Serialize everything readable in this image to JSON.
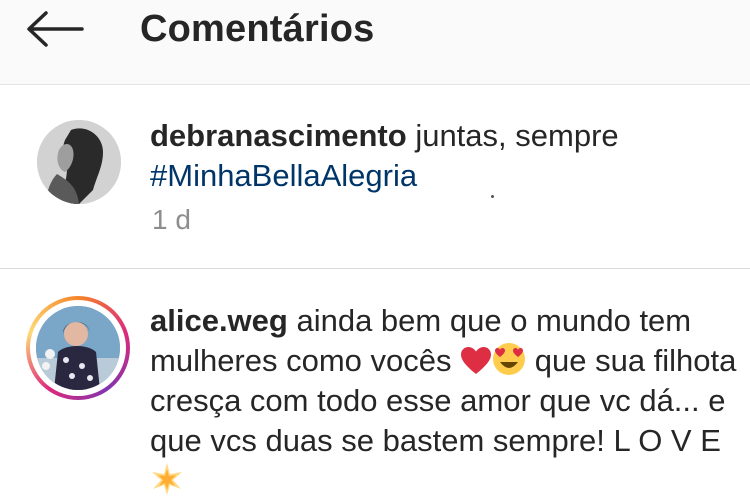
{
  "header": {
    "back_icon": "arrow-left-icon",
    "title": "Comentários"
  },
  "caption": {
    "username": "debranascimento",
    "text": " juntas, sempre",
    "hashtag": "#MinhaBellaAlegria",
    "time": "1 d"
  },
  "comment": {
    "username": "alice.weg",
    "text_part1": " ainda bem que o mundo tem mulheres como vocês ",
    "text_part2": " que sua filhota cresça com todo esse amor que vc dá... e que vcs duas se bastem sempre! L O V E ",
    "emojis": [
      "red-heart-icon",
      "heart-eyes-icon",
      "glowing-star-icon"
    ]
  },
  "colors": {
    "hashtag": "#003569",
    "muted": "#8e8e8e",
    "story_ring": [
      "#f58529",
      "#dd2a7b",
      "#8134af",
      "#feda77"
    ]
  }
}
